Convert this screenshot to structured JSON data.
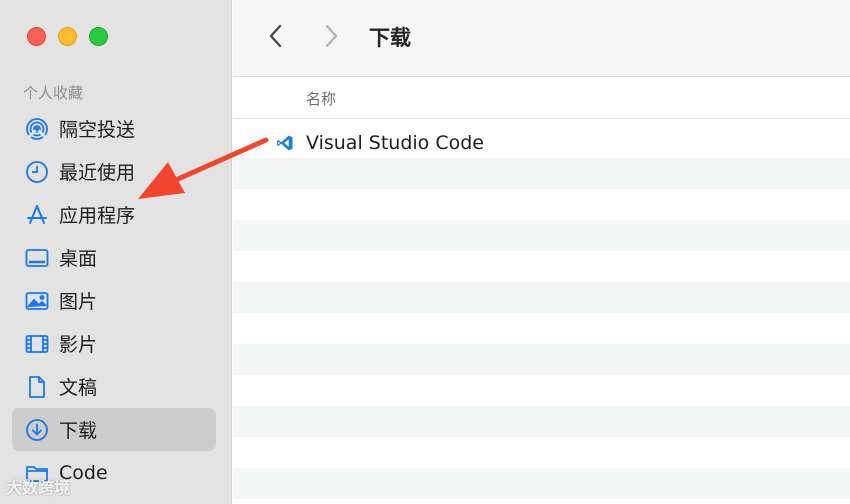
{
  "sidebar": {
    "section_title": "个人收藏",
    "items": [
      {
        "label": "隔空投送",
        "icon": "airdrop-icon"
      },
      {
        "label": "最近使用",
        "icon": "clock-icon"
      },
      {
        "label": "应用程序",
        "icon": "applications-icon"
      },
      {
        "label": "桌面",
        "icon": "desktop-icon"
      },
      {
        "label": "图片",
        "icon": "photo-icon"
      },
      {
        "label": "影片",
        "icon": "film-icon"
      },
      {
        "label": "文稿",
        "icon": "document-icon"
      },
      {
        "label": "下载",
        "icon": "download-icon",
        "selected": true
      },
      {
        "label": "Code",
        "icon": "folder-icon"
      }
    ]
  },
  "toolbar": {
    "title": "下载"
  },
  "list": {
    "column_name": "名称",
    "files": [
      {
        "name": "Visual Studio Code",
        "icon": "vscode-icon"
      }
    ]
  },
  "watermark": "大数跨境",
  "colors": {
    "accent": "#1a78f2",
    "annotation_arrow": "#f2462e"
  }
}
